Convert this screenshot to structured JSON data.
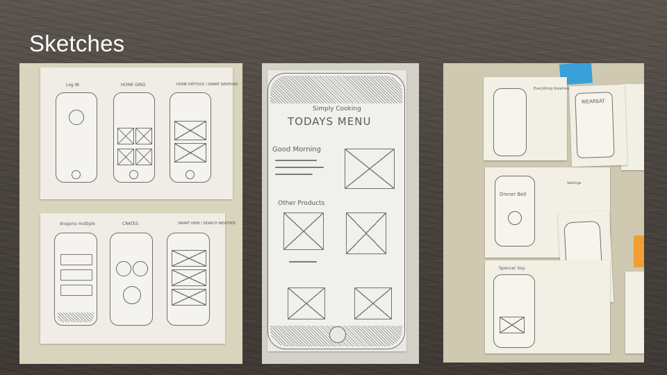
{
  "slide": {
    "title": "Sketches"
  },
  "photos": {
    "left": {
      "top_sheet_labels": [
        "Log IN",
        "HOME GRID",
        "HOME HÄTTOCK / SMART WEATHER"
      ],
      "bottom_sheet_labels": [
        "dragons multiple",
        "CRATES",
        "SMART VIEW / SEARCH WEATHER"
      ]
    },
    "center": {
      "header_text": "Simply Cooking",
      "heading": "TODAYS MENU",
      "section_1": "Good Morning",
      "section_2": "Other Products"
    },
    "right": {
      "note_heading": "WEAREAT",
      "note_title": "Dinner Bell",
      "annotations": [
        "Everything Greatness",
        "Settings",
        "Spencer Say"
      ]
    }
  },
  "colors": {
    "title": "#ffffff",
    "sticky_blue": "#3aa0d8",
    "sticky_orange": "#f0a030"
  }
}
